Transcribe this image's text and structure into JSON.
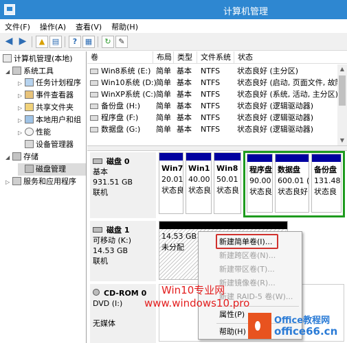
{
  "window": {
    "title": "计算机管理"
  },
  "menu": [
    "文件(F)",
    "操作(A)",
    "查看(V)",
    "帮助(H)"
  ],
  "toolbar": {
    "icons": [
      "back-arrow-icon",
      "forward-arrow-icon",
      "folder-up-icon",
      "show-hide-tree-icon",
      "help-icon",
      "properties-icon",
      "refresh-icon",
      "export-icon"
    ],
    "help_glyph": "?"
  },
  "tree": {
    "root": "计算机管理(本地)",
    "system_tools": "系统工具",
    "task_scheduler": "任务计划程序",
    "event_viewer": "事件查看器",
    "shared_folders": "共享文件夹",
    "local_users": "本地用户和组",
    "performance": "性能",
    "device_manager": "设备管理器",
    "storage": "存储",
    "disk_management": "磁盘管理",
    "services": "服务和应用程序"
  },
  "volume_columns": [
    "卷",
    "布局",
    "类型",
    "文件系统",
    "状态"
  ],
  "volumes": [
    {
      "name": "Win8系统 (E:)",
      "layout": "简单",
      "type": "基本",
      "fs": "NTFS",
      "status": "状态良好 (主分区)"
    },
    {
      "name": "Win10系统 (D:)",
      "layout": "简单",
      "type": "基本",
      "fs": "NTFS",
      "status": "状态良好 (启动, 页面文件, 故障"
    },
    {
      "name": "WinXP系统 (C:)",
      "layout": "简单",
      "type": "基本",
      "fs": "NTFS",
      "status": "状态良好 (系统, 活动, 主分区)"
    },
    {
      "name": "备份盘 (H:)",
      "layout": "简单",
      "type": "基本",
      "fs": "NTFS",
      "status": "状态良好 (逻辑驱动器)"
    },
    {
      "name": "程序盘 (F:)",
      "layout": "简单",
      "type": "基本",
      "fs": "NTFS",
      "status": "状态良好 (逻辑驱动器)"
    },
    {
      "name": "数据盘 (G:)",
      "layout": "简单",
      "type": "基本",
      "fs": "NTFS",
      "status": "状态良好 (逻辑驱动器)"
    }
  ],
  "disk0": {
    "name": "磁盘 0",
    "type": "基本",
    "size": "931.51 GB",
    "status": "联机",
    "partitions": [
      {
        "name": "Win7",
        "size": "20.01",
        "status": "状态良"
      },
      {
        "name": "Win1",
        "size": "40.00",
        "status": "状态良"
      },
      {
        "name": "Win8",
        "size": "50.01",
        "status": "状态良"
      },
      {
        "name": "程序盘",
        "size": "90.00",
        "status": "状态良"
      },
      {
        "name": "数据盘",
        "size": "600.01 (",
        "status": "状态良好"
      },
      {
        "name": "备份盘",
        "size": "131.48",
        "status": "状态良"
      }
    ]
  },
  "disk1": {
    "name": "磁盘 1",
    "type": "可移动 (K:)",
    "size": "14.53 GB",
    "status": "联机",
    "unallocated_size": "14.53 GB",
    "unallocated_label": "未分配"
  },
  "cdrom": {
    "name": "CD-ROM 0",
    "type": "DVD (I:)",
    "status": "无媒体"
  },
  "context_menu": {
    "new_simple": "新建简单卷(I)...",
    "new_spanned": "新建跨区卷(N)...",
    "new_striped": "新建带区卷(T)...",
    "new_mirror": "新建镜像卷(R)...",
    "new_raid5": "新建 RAID-5 卷(W)...",
    "properties": "属性(P)",
    "help": "帮助(H)"
  },
  "watermark": {
    "line1": "Win10专业网",
    "line2": "www.windows10.pro"
  },
  "logo": {
    "line1": "Office教程网",
    "line2": "office66.cn"
  },
  "colors": {
    "titlebar": "#2e87d1",
    "partition_bar": "#0000a0",
    "selection_green": "#1e9b1e",
    "highlight_red": "#d0312d",
    "watermark_red": "#e31e1e",
    "logo_orange": "#e8531f",
    "logo_blue": "#2a7bd6"
  }
}
